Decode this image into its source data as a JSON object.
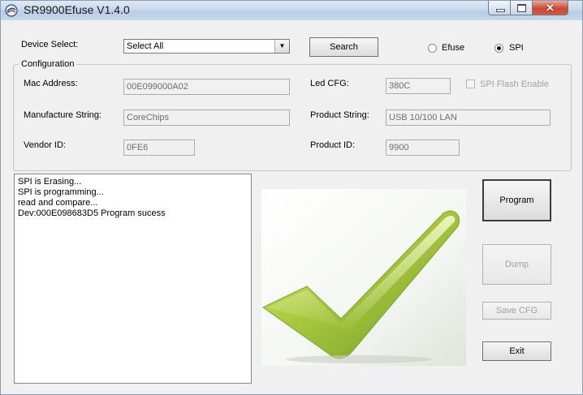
{
  "window": {
    "title": "SR9900Efuse V1.4.0"
  },
  "device": {
    "label": "Device Select:",
    "selected": "Select All",
    "search_label": "Search",
    "modes": [
      {
        "label": "Efuse",
        "checked": false
      },
      {
        "label": "SPI",
        "checked": true
      }
    ]
  },
  "configuration": {
    "title": "Configuration",
    "mac_label": "Mac Address:",
    "mac_value": "00E099000A02",
    "led_label": "Led CFG:",
    "led_value": "380C",
    "spi_flash_label": "SPI Flash Enable",
    "manufacture_label": "Manufacture String:",
    "manufacture_value": "CoreChips",
    "product_string_label": "Product String:",
    "product_string_value": "USB 10/100 LAN",
    "vendor_label": "Vendor ID:",
    "vendor_value": "0FE6",
    "product_id_label": "Product ID:",
    "product_id_value": "9900"
  },
  "log": {
    "lines": [
      "SPI is Erasing...",
      "SPI is programming...",
      "read and compare...",
      "Dev:000E098683D5  Program sucess"
    ]
  },
  "actions": {
    "program_label": "Program",
    "dump_label": "Dump",
    "save_cfg_label": "Save CFG",
    "exit_label": "Exit"
  },
  "colors": {
    "check_light": "#d8e86a",
    "check_dark": "#6f9a2a",
    "close_button": "#c94a34"
  }
}
